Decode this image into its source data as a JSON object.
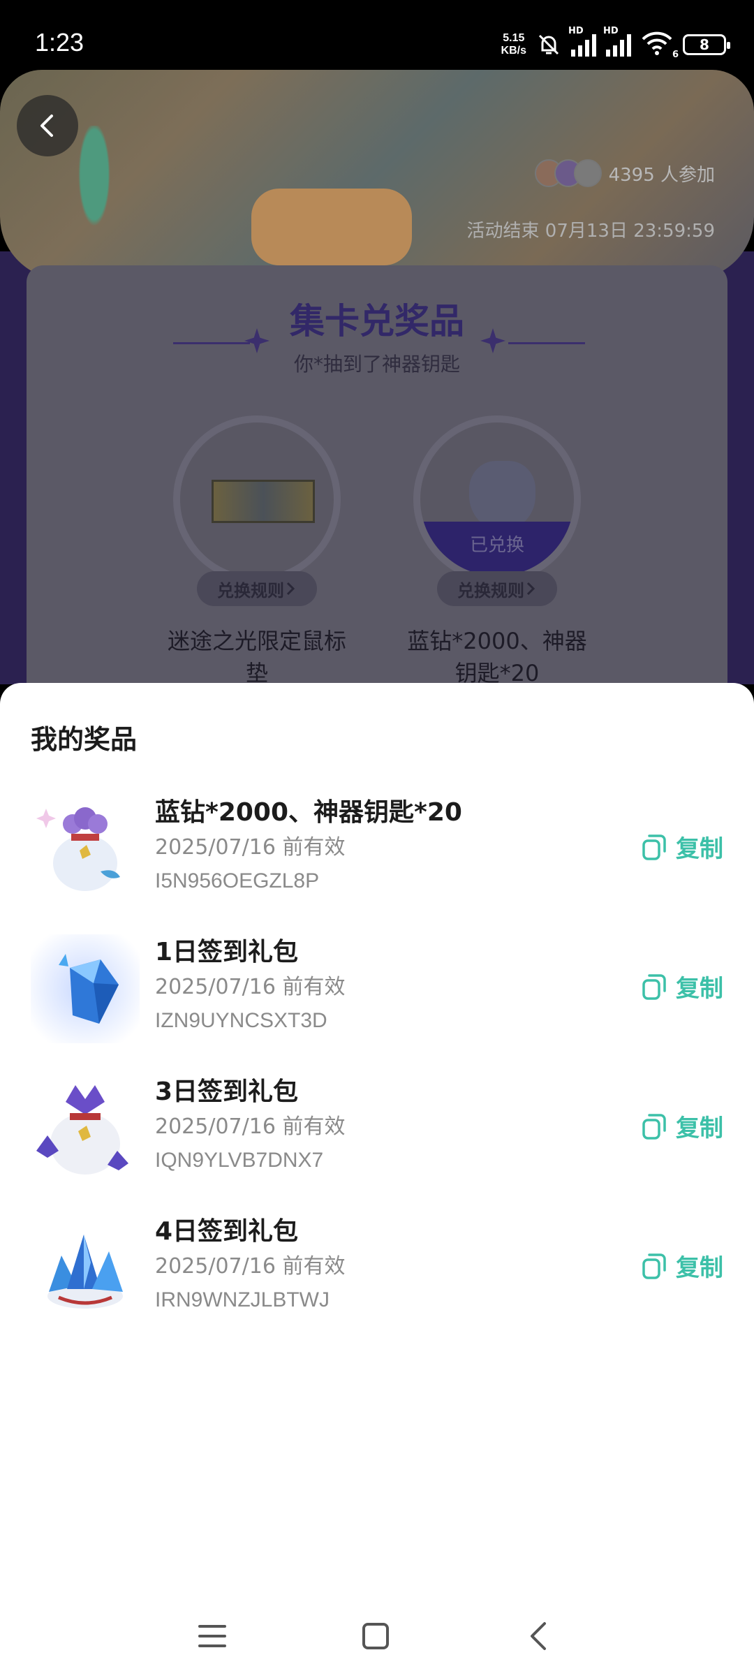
{
  "status_bar": {
    "time": "1:23",
    "net_speed_value": "5.15",
    "net_speed_unit": "KB/s",
    "hd1": "HD",
    "hd2": "HD",
    "wifi_badge": "6",
    "battery": "8"
  },
  "banner": {
    "participants": "4395 人参加",
    "end_time": "活动结束 07月13日 23:59:59"
  },
  "card": {
    "title": "集卡兑奖品",
    "subtitle": "你*抽到了神器钥匙",
    "prizes": [
      {
        "name": "迷途之光限定鼠标垫",
        "rule_label": "兑换规则",
        "exchanged": ""
      },
      {
        "name": "蓝钻*2000、神器钥匙*20",
        "rule_label": "兑换规则",
        "exchanged": "已兑换"
      }
    ]
  },
  "sheet": {
    "title": "我的奖品",
    "items": [
      {
        "title": "蓝钻*2000、神器钥匙*20",
        "date": "2025/07/16 前有效",
        "code": "I5N956OEGZL8P",
        "copy_label": "复制"
      },
      {
        "title": "1日签到礼包",
        "date": "2025/07/16 前有效",
        "code": "IZN9UYNCSXT3D",
        "copy_label": "复制"
      },
      {
        "title": "3日签到礼包",
        "date": "2025/07/16 前有效",
        "code": "IQN9YLVB7DNX7",
        "copy_label": "复制"
      },
      {
        "title": "4日签到礼包",
        "date": "2025/07/16 前有效",
        "code": "IRN9WNZJLBTWJ",
        "copy_label": "复制"
      }
    ]
  },
  "colors": {
    "accent": "#3cc0a8",
    "card_title": "#322868",
    "overlay_purple": "#2b2150"
  },
  "icons": {
    "back": "chevron-left-icon",
    "copy": "copy-icon",
    "nav": [
      "menu-icon",
      "home-icon",
      "back-icon"
    ]
  }
}
